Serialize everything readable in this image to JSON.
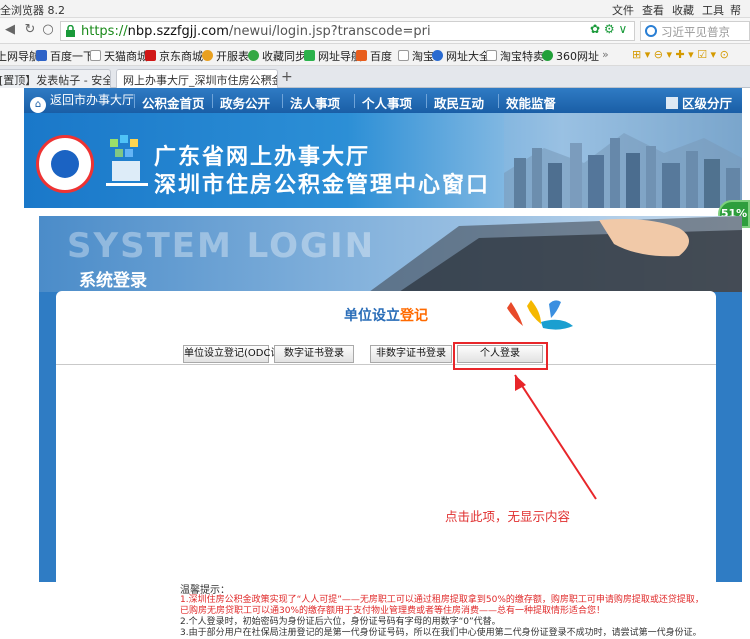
{
  "browser": {
    "app_title": "全浏览器 8.2",
    "menu": [
      "文件",
      "查看",
      "收藏",
      "工具",
      "帮助"
    ],
    "url_protocol": "https://",
    "url_host": "nbp.szzfgjj.com",
    "url_path": "/newui/login.jsp?transcode=pri",
    "search_placeholder": "习近平见普京",
    "bookmarks": [
      "上网导航",
      "百度一下",
      "天猫商城",
      "京东商城",
      "开服表",
      "收藏同步",
      "网址导航",
      "百度",
      "淘宝",
      "网址大全",
      "淘宝特卖",
      "360网址"
    ],
    "tabs": [
      {
        "label": "[置顶】发表帖子 - 安全浏览",
        "active": false
      },
      {
        "label": "网上办事大厅_深圳市住房公积金",
        "active": true
      }
    ],
    "colors": {
      "accent": "#2f7bc4",
      "url_green": "#1a8a1a"
    }
  },
  "site_nav": {
    "home_label": "返回市办事大厅",
    "items": [
      "公积金首页",
      "政务公开",
      "法人事项",
      "个人事项",
      "政民互动",
      "效能监督"
    ],
    "district_label": "区级分厅"
  },
  "banner": {
    "line1": "广东省网上办事大厅",
    "line2": "深圳市住房公积金管理中心窗口"
  },
  "badge_percent": "51%",
  "login": {
    "watermark": "SYSTEM LOGIN",
    "heading": "系统登录",
    "title_part1": "单位设立",
    "title_part2": "登记",
    "tabs": [
      "单位设立登记(ODC设立)",
      "数字证书登录",
      "非数字证书登录",
      "个人登录"
    ],
    "annotation": "点击此项，无显示内容",
    "tips_title": "温馨提示：",
    "tips": [
      "1.深圳住房公积金政策实现了“人人可提”——无房职工可以通过租房提取拿到50%的缴存额，购房职工可申请购房提取或还贷提取，",
      "已购房无房贷职工可以通30%的缴存额用于支付物业管理费或者等住房消费——总有一种提取情形适合您！",
      "2.个人登录时，初始密码为身份证后六位，身份证号码有字母的用数字“0”代替。",
      "3.由于部分用户在社保局注册登记的是第一代身份证号码，所以在我们中心使用第二代身份证登录不成功时，请尝试第一代身份证。"
    ]
  }
}
